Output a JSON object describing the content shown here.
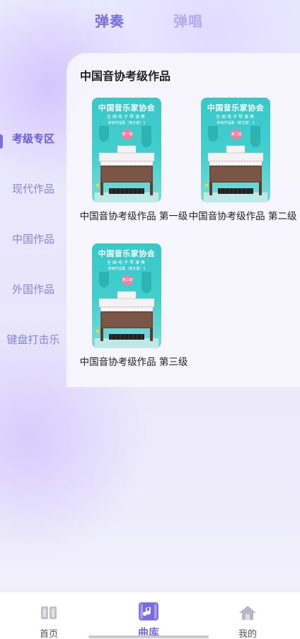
{
  "top_tabs": [
    {
      "label": "弹奏",
      "active": true
    },
    {
      "label": "弹唱",
      "active": false
    }
  ],
  "sidebar": {
    "items": [
      {
        "label": "考级专区",
        "active": true
      },
      {
        "label": "现代作品",
        "active": false
      },
      {
        "label": "中国作品",
        "active": false
      },
      {
        "label": "外国作品",
        "active": false
      },
      {
        "label": "键盘打击乐",
        "active": false
      }
    ]
  },
  "main": {
    "section_title": "中国音协考级作品",
    "cards": [
      {
        "title": "中国音协考级作品 第一级",
        "cover_title": "中国音乐家协会",
        "cover_sub": "全国电子琴演奏",
        "cover_sub2": "考级作品集（第五套）1",
        "badge": "第一级"
      },
      {
        "title": "中国音协考级作品 第二级",
        "cover_title": "中国音乐家协会",
        "cover_sub": "全国电子琴演奏",
        "cover_sub2": "考级作品集（第五套）1",
        "badge": "第二级"
      },
      {
        "title": "中国音协考级作品 第三级",
        "cover_title": "中国音乐家协会",
        "cover_sub": "全国电子琴演奏",
        "cover_sub2": "考级作品集（第五套）1",
        "badge": "第三级"
      }
    ]
  },
  "bottom_nav": [
    {
      "label": "首页",
      "icon": "book-icon",
      "active": false
    },
    {
      "label": "曲库",
      "icon": "music-library-icon",
      "active": true
    },
    {
      "label": "我的",
      "icon": "home-icon",
      "active": false
    }
  ],
  "colors": {
    "accent": "#7566e3",
    "cover_teal": "#39c7c8",
    "inactive_tab": "#b4aaf0"
  }
}
